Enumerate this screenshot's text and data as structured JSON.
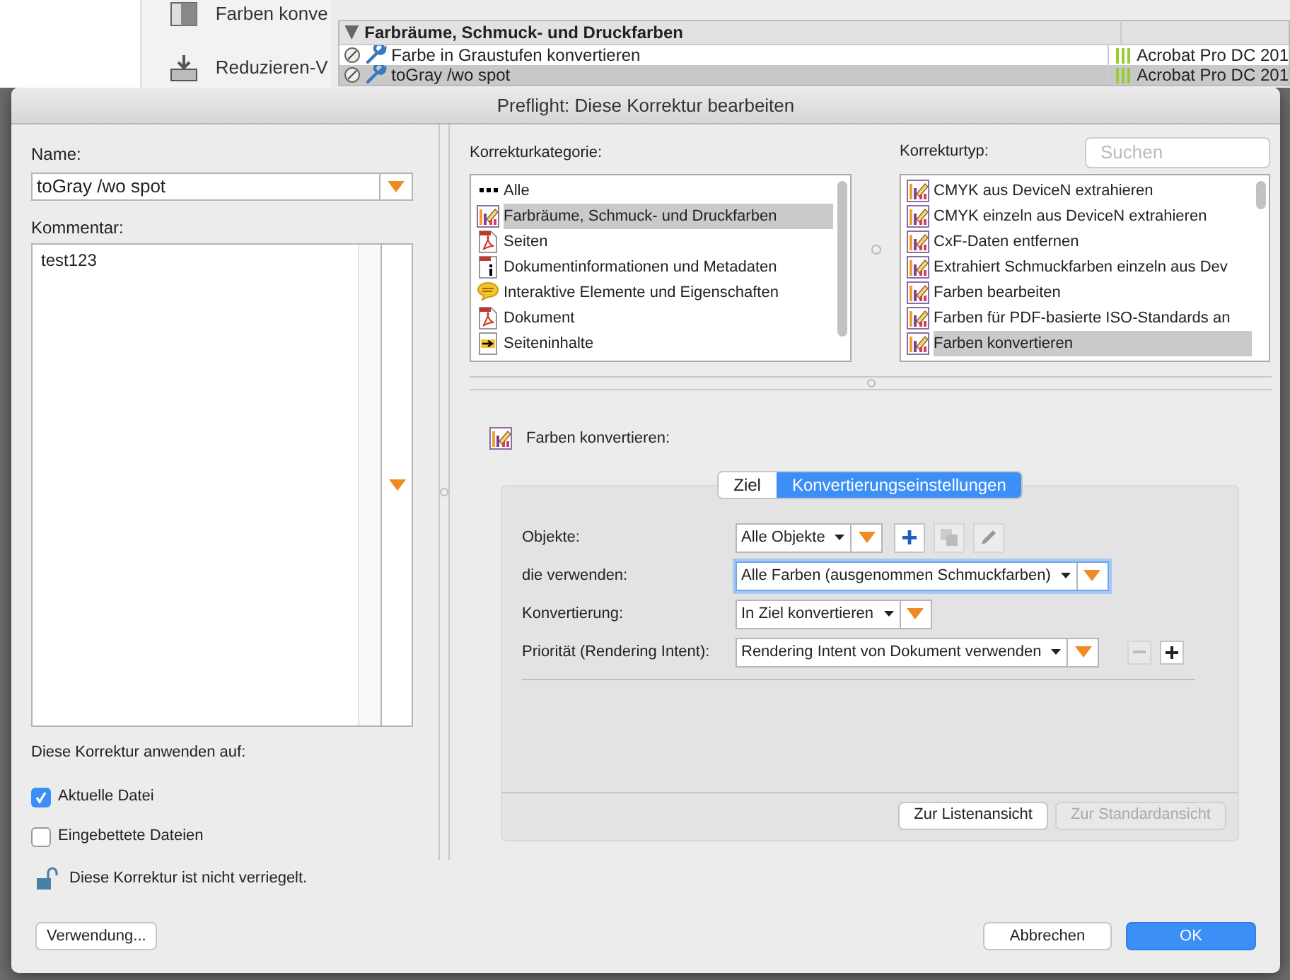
{
  "background": {
    "sidebar_items": [
      {
        "label": "Farben konve",
        "kind": "swatch"
      },
      {
        "label": "Reduzieren-V",
        "kind": "flatten"
      }
    ],
    "group": {
      "label": "Farbräume, Schmuck- und Druckfarben",
      "expanded": true
    },
    "rows": [
      {
        "label": "Farbe in Graustufen konvertieren",
        "version": "Acrobat Pro DC 201",
        "selected": false
      },
      {
        "label": "toGray /wo spot",
        "version": "Acrobat Pro DC 201",
        "selected": true
      }
    ]
  },
  "dialog": {
    "title": "Preflight: Diese Korrektur bearbeiten",
    "name_label": "Name:",
    "name_value": "toGray /wo spot",
    "comment_label": "Kommentar:",
    "comment_value": "test123",
    "apply_label": "Diese Korrektur anwenden auf:",
    "apply_options": [
      {
        "label": "Aktuelle Datei",
        "checked": true
      },
      {
        "label": "Eingebettete Dateien",
        "checked": false
      }
    ],
    "lock": {
      "text": "Diese Korrektur ist nicht verriegelt.",
      "locked": false
    },
    "usage_button": "Verwendung...",
    "category_label": "Korrekturkategorie:",
    "categories": [
      {
        "label": "Alle",
        "kind": "dots",
        "selected": false
      },
      {
        "label": "Farbräume, Schmuck- und Druckfarben",
        "kind": "color",
        "selected": true
      },
      {
        "label": "Seiten",
        "kind": "pdf",
        "selected": false
      },
      {
        "label": "Dokumentinformationen und Metadaten",
        "kind": "info",
        "selected": false
      },
      {
        "label": "Interaktive Elemente und Eigenschaften",
        "kind": "comment",
        "selected": false
      },
      {
        "label": "Dokument",
        "kind": "pdf",
        "selected": false
      },
      {
        "label": "Seiteninhalte",
        "kind": "arrow",
        "selected": false
      }
    ],
    "type_label": "Korrekturtyp:",
    "search_placeholder": "Suchen",
    "types": [
      {
        "label": "CMYK aus DeviceN extrahieren",
        "selected": false
      },
      {
        "label": "CMYK einzeln aus DeviceN extrahieren",
        "selected": false
      },
      {
        "label": "CxF-Daten entfernen",
        "selected": false
      },
      {
        "label": "Extrahiert Schmuckfarben einzeln aus Dev",
        "selected": false
      },
      {
        "label": "Farben bearbeiten",
        "selected": false
      },
      {
        "label": "Farben für PDF-basierte ISO-Standards an",
        "selected": false
      },
      {
        "label": "Farben konvertieren",
        "selected": true
      }
    ],
    "fixup_title": "Farben konvertieren:",
    "tabs": [
      {
        "label": "Ziel",
        "selected": false
      },
      {
        "label": "Konvertierungseinstellungen",
        "selected": true
      }
    ],
    "settings": [
      {
        "label": "Objekte:",
        "value": "Alle Objekte",
        "focused": false,
        "kind": "edit"
      },
      {
        "label": "die verwenden:",
        "value": "Alle Farben (ausgenommen Schmuckfarben)",
        "focused": true,
        "kind": "plain"
      },
      {
        "label": "Konvertierung:",
        "value": "In Ziel konvertieren",
        "focused": false,
        "kind": "plain"
      },
      {
        "label": "Priorität (Rendering Intent):",
        "value": "Rendering Intent von Dokument verwenden",
        "focused": false,
        "kind": "plusminus"
      }
    ],
    "view_buttons": [
      {
        "label": "Zur Listenansicht",
        "disabled": false
      },
      {
        "label": "Zur Standardansicht",
        "disabled": true
      }
    ],
    "cancel_button": "Abbrechen",
    "ok_button": "OK"
  }
}
